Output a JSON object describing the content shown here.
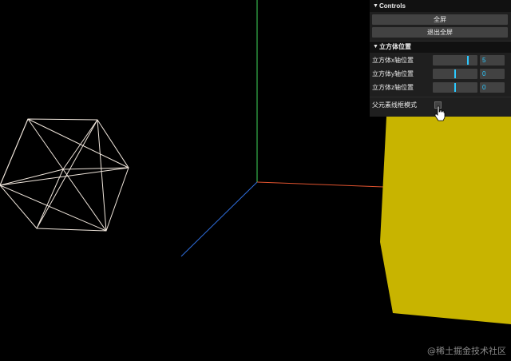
{
  "colors": {
    "background": "#000000",
    "x_axis": "#e0532f",
    "y_axis": "#3fd85a",
    "z_axis": "#2f6fe0",
    "cube_fill": "#c8b400",
    "wireframe": "#f0e6dc",
    "accent": "#2cc9ff"
  },
  "gui": {
    "title": "Controls",
    "fullscreen_label": "全屏",
    "exit_fullscreen_label": "退出全屏",
    "folder_title": "立方体位置",
    "sliders": [
      {
        "label": "立方体x轴位置",
        "value": "5",
        "fraction": 0.79
      },
      {
        "label": "立方体y轴位置",
        "value": "0",
        "fraction": 0.5
      },
      {
        "label": "立方体z轴位置",
        "value": "0",
        "fraction": 0.5
      }
    ],
    "checkbox": {
      "label": "父元素线框模式",
      "checked": false
    }
  },
  "watermark": "@稀土掘金技术社区"
}
